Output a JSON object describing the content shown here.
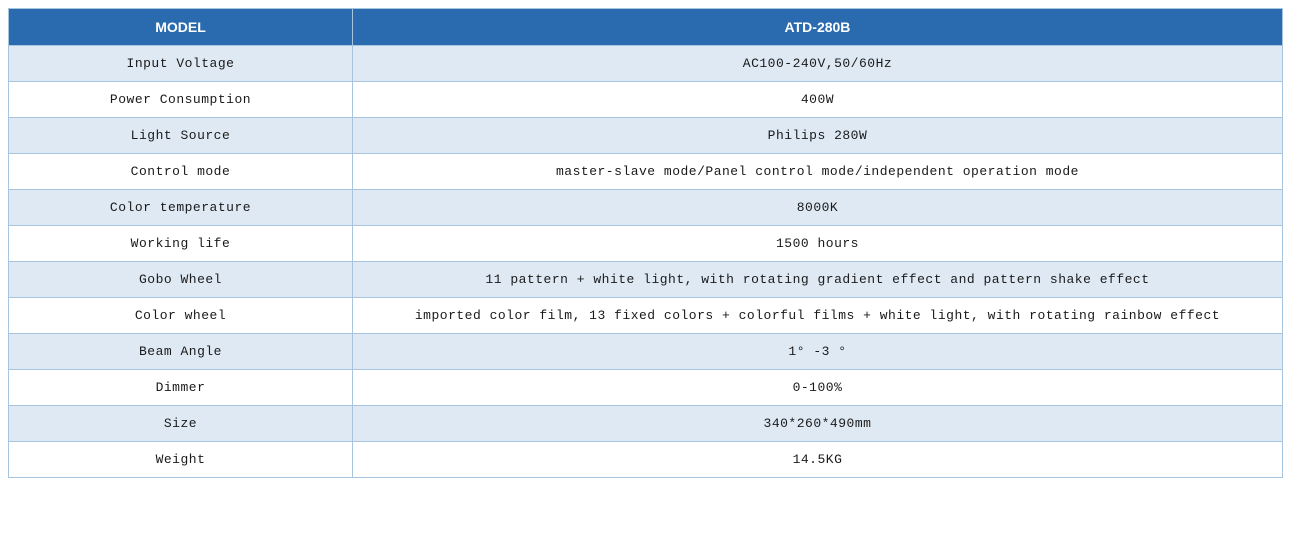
{
  "headers": {
    "label": "MODEL",
    "value": "ATD-280B"
  },
  "rows": [
    {
      "label": "Input Voltage",
      "value": "AC100-240V,50/60Hz"
    },
    {
      "label": "Power Consumption",
      "value": "400W"
    },
    {
      "label": "Light Source",
      "value": "Philips 280W"
    },
    {
      "label": "Control mode",
      "value": "master-slave mode/Panel control mode/independent operation mode"
    },
    {
      "label": "Color temperature",
      "value": "8000K"
    },
    {
      "label": "Working life",
      "value": "1500 hours"
    },
    {
      "label": "Gobo Wheel",
      "value": "11 pattern + white light, with rotating gradient effect and pattern shake effect"
    },
    {
      "label": "Color wheel",
      "value": "imported color film, 13 fixed colors + colorful films + white light, with rotating rainbow effect"
    },
    {
      "label": "Beam Angle",
      "value": "1°  -3 °"
    },
    {
      "label": "Dimmer",
      "value": "0-100%"
    },
    {
      "label": "Size",
      "value": "340*260*490mm"
    },
    {
      "label": "Weight",
      "value": "14.5KG"
    }
  ]
}
